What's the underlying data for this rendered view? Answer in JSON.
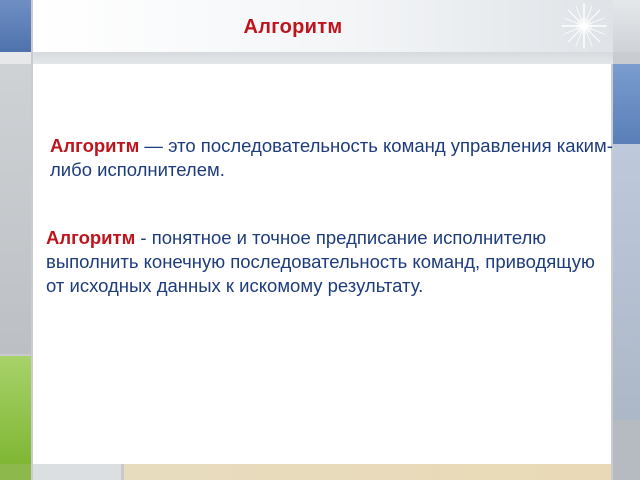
{
  "slide": {
    "title": "Алгоритм",
    "paragraphs": [
      {
        "term": "Алгоритм",
        "text": " — это последовательность команд управления каким-либо исполнителем."
      },
      {
        "term": "Алгоритм",
        "text": " - понятное и точное предписание исполнителю выполнить конечную последовательность команд, приводящую от исходных данных к искомому результату."
      }
    ]
  },
  "colors": {
    "title": "#c0141c",
    "term": "#c0141c",
    "body_text": "#1e3c7b",
    "accent_blue": "#5a7fb8",
    "accent_green": "#7fb734"
  },
  "icons": {
    "sparkle": "sparkle-icon"
  }
}
